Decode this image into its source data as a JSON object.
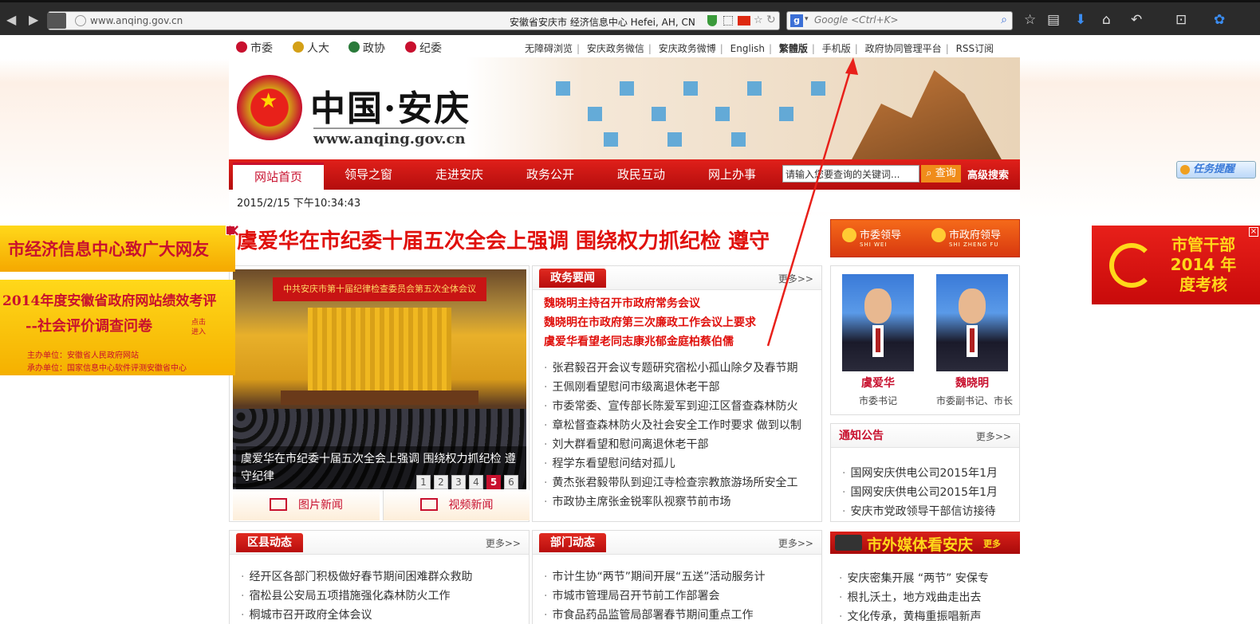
{
  "browser": {
    "url": "www.anqing.gov.cn",
    "geo": "安徽省安庆市 经济信息中心   Hefei, AH, CN",
    "search_placeholder": "Google <Ctrl+K>"
  },
  "top_links": [
    {
      "label": "市委",
      "color": "#c8102e"
    },
    {
      "label": "人大",
      "color": "#d4a017"
    },
    {
      "label": "政协",
      "color": "#2a7a3a"
    },
    {
      "label": "纪委",
      "color": "#c8102e"
    }
  ],
  "util_links": [
    "无障碍浏览",
    "安庆政务微信",
    "安庆政务微博",
    "English",
    "繁體版",
    "手机版",
    "政府协同管理平台",
    "RSS订阅"
  ],
  "logo": {
    "title": "中国·安庆",
    "url": "www.anqing.gov.cn"
  },
  "nav": {
    "items": [
      "网站首页",
      "领导之窗",
      "走进安庆",
      "政务公开",
      "政民互动",
      "网上办事"
    ],
    "search_placeholder": "请输入您要查询的关键词...",
    "search_button": "查询",
    "advanced": "高级搜索"
  },
  "date": "2015/2/15 下午10:34:43",
  "headline": "虞爱华在市纪委十届五次全会上强调 围绕权力抓纪检  遵守",
  "photo": {
    "banner_text": "中共安庆市第十届纪律检查委员会第五次全体会议",
    "caption": "虞爱华在市纪委十届五次全会上强调 围绕权力抓纪检 遵守纪律",
    "pages": [
      "1",
      "2",
      "3",
      "4",
      "5",
      "6"
    ],
    "active_page": "5",
    "tab_pic": "图片新闻",
    "tab_video": "视频新闻"
  },
  "gov_news": {
    "title": "政务要闻",
    "more": "更多>>",
    "featured": [
      "魏晓明主持召开市政府常务会议",
      "魏晓明在市政府第三次廉政工作会议上要求",
      "虞爱华看望老同志康兆郁金庭柏蔡伯儒"
    ],
    "items": [
      "张君毅召开会议专题研究宿松小孤山除夕及春节期",
      "王佩刚看望慰问市级离退休老干部",
      "市委常委、宣传部长陈爱军到迎江区督查森林防火",
      "章松督查森林防火及社会安全工作时要求 做到以制",
      "刘大群看望和慰问离退休老干部",
      "程学东看望慰问结对孤儿",
      "黄杰张君毅带队到迎江寺检查宗教旅游场所安全工",
      "市政协主席张金锐率队视察节前市场"
    ]
  },
  "leader_tabs": [
    {
      "label": "市委领导",
      "sub": "SHI WEI"
    },
    {
      "label": "市政府领导",
      "sub": "SHI ZHENG FU"
    }
  ],
  "leaders": [
    {
      "name": "虞爱华",
      "role": "市委书记"
    },
    {
      "name": "魏晓明",
      "role": "市委副书记、市长"
    }
  ],
  "notice": {
    "title": "通知公告",
    "more": "更多>>",
    "items": [
      "国网安庆供电公司2015年1月",
      "国网安庆供电公司2015年1月",
      "安庆市党政领导干部信访接待"
    ]
  },
  "county": {
    "title": "区县动态",
    "more": "更多>>",
    "items": [
      "经开区各部门积极做好春节期间困难群众救助",
      "宿松县公安局五项措施强化森林防火工作",
      "桐城市召开政府全体会议"
    ]
  },
  "dept": {
    "title": "部门动态",
    "more": "更多>>",
    "items": [
      "市计生协“两节”期间开展“五送”活动服务计",
      "市城市管理局召开节前工作部署会",
      "市食品药品监管局部署春节期间重点工作"
    ]
  },
  "media": {
    "title": "市外媒体看安庆",
    "more": "更多",
    "items": [
      "安庆密集开展 “两节” 安保专",
      "根扎沃土，地方戏曲走出去",
      "文化传承，黄梅重振唱新声"
    ]
  },
  "ads": {
    "left1": "市经济信息中心致广大网友",
    "left2_l1": "2014年度安徽省政府网站绩效考评",
    "left2_l2": "--社会评价调查问卷",
    "left2_hint": "点击进入",
    "left2_l3": "主办单位：安徽省人民政府网站",
    "left2_l4": "承办单位：国家信息中心软件评测安徽省中心",
    "right": "市管干部 2014 年度考核",
    "close": "×"
  },
  "task_remind": "任务提醒"
}
